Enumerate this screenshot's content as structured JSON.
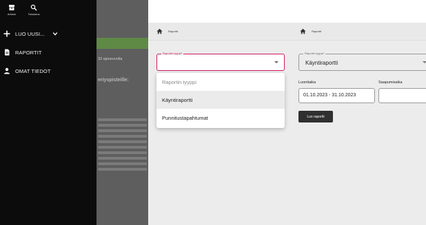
{
  "colors": {
    "accent": "#d0175d",
    "drawer": "#0c0c0c",
    "panel": "#ececec"
  },
  "screen1": {
    "top_icons": [
      {
        "icon": "archive-icon",
        "label": "Arkisto"
      },
      {
        "icon": "search-icon",
        "label": "Tarkastus"
      }
    ],
    "menu": {
      "create_new": "LUO UUSI...",
      "reports": "RAPORTIT",
      "own_info": "OMAT TIEDOT"
    },
    "background": {
      "frag1": "33 ajoneuvolla",
      "frag2": "eriyspisteille:"
    }
  },
  "screen2": {
    "breadcrumb": "Raportit",
    "field_label": "Raportin tyyppi*",
    "options": [
      "Raportin tyyppi",
      "Käyntiraportti",
      "Punnitustapahtumat"
    ]
  },
  "screen3": {
    "breadcrumb": "Raportit",
    "field_label": "Raportin tyyppi*",
    "field_value": "Käyntiraportti",
    "label_created": "Luontiaika",
    "label_arrival": "Saapumisaika",
    "created_range": "01.10.2023 - 31.10.2023",
    "button": "Luo raportti"
  }
}
